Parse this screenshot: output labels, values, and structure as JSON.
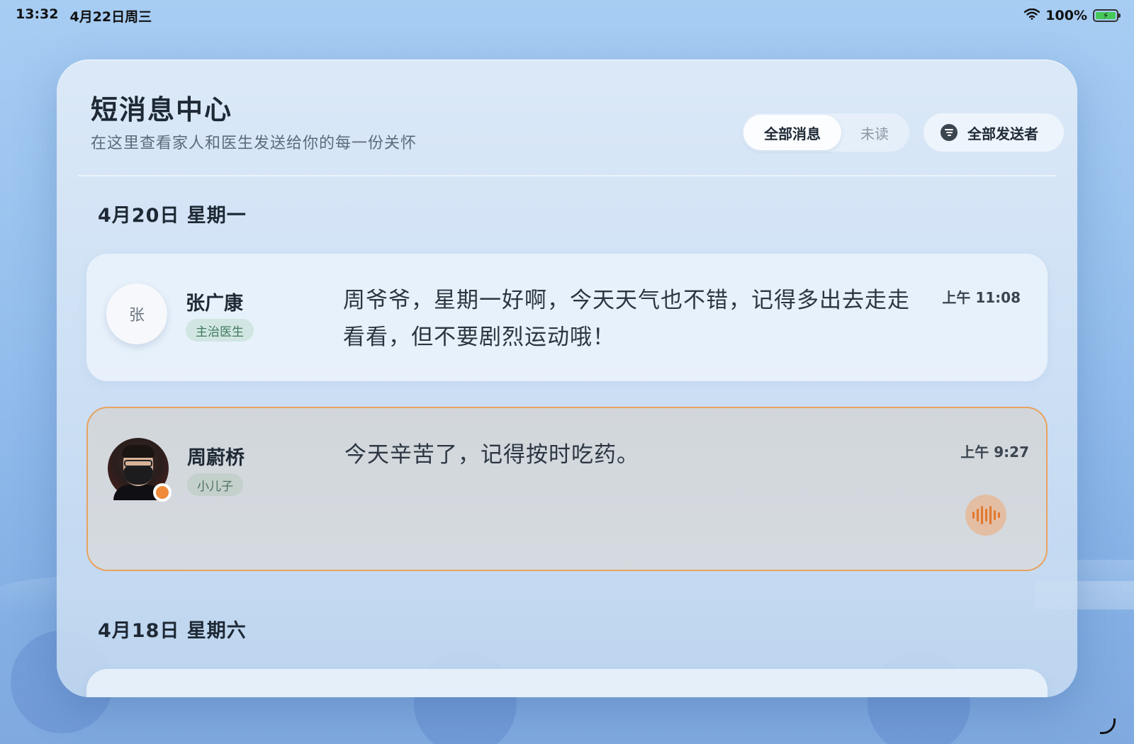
{
  "status_bar": {
    "time": "13:32",
    "date": "4月22日周三",
    "battery_percent": "100%",
    "icons": [
      "wifi-icon",
      "battery-charging-icon"
    ]
  },
  "header": {
    "title": "短消息中心",
    "subtitle": "在这里查看家人和医生发送给你的每一份关怀",
    "tabs": [
      {
        "label": "全部消息",
        "active": true
      },
      {
        "label": "未读",
        "active": false
      }
    ],
    "filter_label": "全部发送者"
  },
  "groups": [
    {
      "date": "4月20日 星期一",
      "messages": [
        {
          "sender": "张广康",
          "avatar_letter": "张",
          "role": "主治医生",
          "text": "周爷爷，星期一好啊，今天天气也不错，记得多出去走走看看，但不要剧烈运动哦！",
          "time": "上午 11:08",
          "unread": false
        },
        {
          "sender": "周蔚桥",
          "role": "小儿子",
          "text": "今天辛苦了，记得按时吃药。",
          "time": "上午 9:27",
          "unread": true,
          "has_voice": true
        }
      ]
    },
    {
      "date": "4月18日 星期六",
      "messages": []
    }
  ],
  "colors": {
    "accent_unread": "#e8a25f",
    "online_dot": "#ef8a3a",
    "doctor_tag": "#3f7a5f"
  }
}
